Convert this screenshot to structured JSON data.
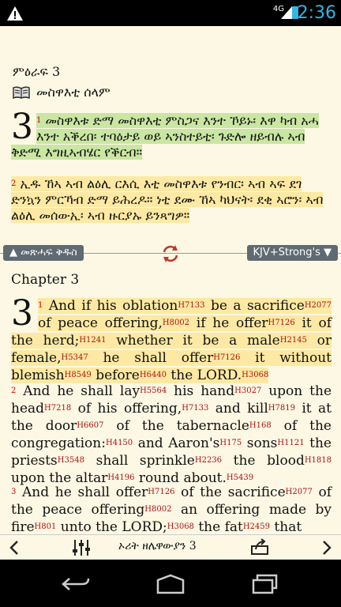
{
  "status": {
    "network": "4G",
    "time": "2:36"
  },
  "top": {
    "chapter_label": "ምዕራፍ  3",
    "section_title": "መስዋእቲ ሰላም",
    "verse1_no": "3",
    "verse1_sup": "1",
    "verse1_text": "መስዋእቱ ድማ መስዋእቲ ምስጋና እንተ ኾይኑ፡ እዋ ካብ አሓ እንተ አቕረበ፡ ተባዕታይ ወይ ኣንስተይቲ፡ ጉድሎ ዘይብሉ ኣብ ቅድሚ እግዚኣብሄር የቕርብ።",
    "verse2_sup": "2",
    "verse2_text": "ኢዱ ኸኣ ኣብ ልዕሊ ርእሲ እቲ መስዋእቱ የንብር፡ ኣብ ኣፍ ደገ ድንኳን ምርኻብ ድማ ይሕረዶ። ነቲ ደሙ ኸኣ ካህናት፡ ደቂ ኣሮን፡ ኣብ ልዕሊ መሰውኢ፡ ኣብ ዙርያኡ ይንጻግዎ።"
  },
  "divider": {
    "left_label": "መጽሓፍ ቅዱስ",
    "right_label": "KJV+Strong's"
  },
  "bottom": {
    "chapter_label": "Chapter  3",
    "v1_no": "3",
    "v1_sup": "1",
    "v2_sup": "2",
    "v3_sup": "3"
  },
  "toolbar": {
    "book_chapter": "ኦሪት ዘሌዋውያን  3"
  }
}
